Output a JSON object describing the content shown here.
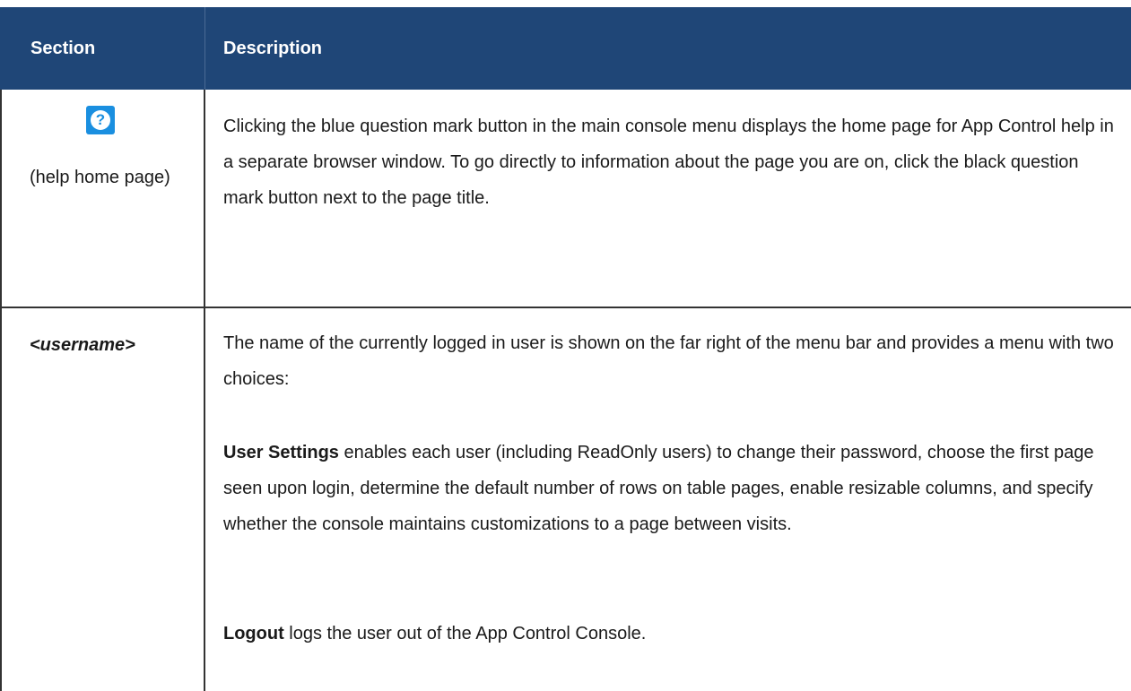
{
  "table": {
    "header": {
      "section": "Section",
      "description": "Description"
    },
    "rows": [
      {
        "icon": "help-question-icon",
        "icon_glyph": "?",
        "section_label": "(help home page)",
        "description": "Clicking the blue question mark button in the main console menu displays the home page for App Control help in a separate browser window. To go directly to information about the page you are on, click the black question mark button next to the page title."
      },
      {
        "section_label": "<username>",
        "description_intro": "The name of the currently logged in user is shown on the far right of the menu bar and provides a menu with two choices:",
        "user_settings_term": "User Settings",
        "user_settings_text": " enables each user (including ReadOnly users) to change their password, choose the first page seen upon login, determine the default number of rows on table pages, enable resizable columns, and specify whether the console maintains customizations to a page between visits.",
        "logout_term": "Logout",
        "logout_text": " logs the user out of the App Control Console."
      }
    ]
  },
  "colors": {
    "header_bg": "#1f4677",
    "header_text": "#ffffff",
    "help_icon_bg": "#1a8fe0"
  }
}
